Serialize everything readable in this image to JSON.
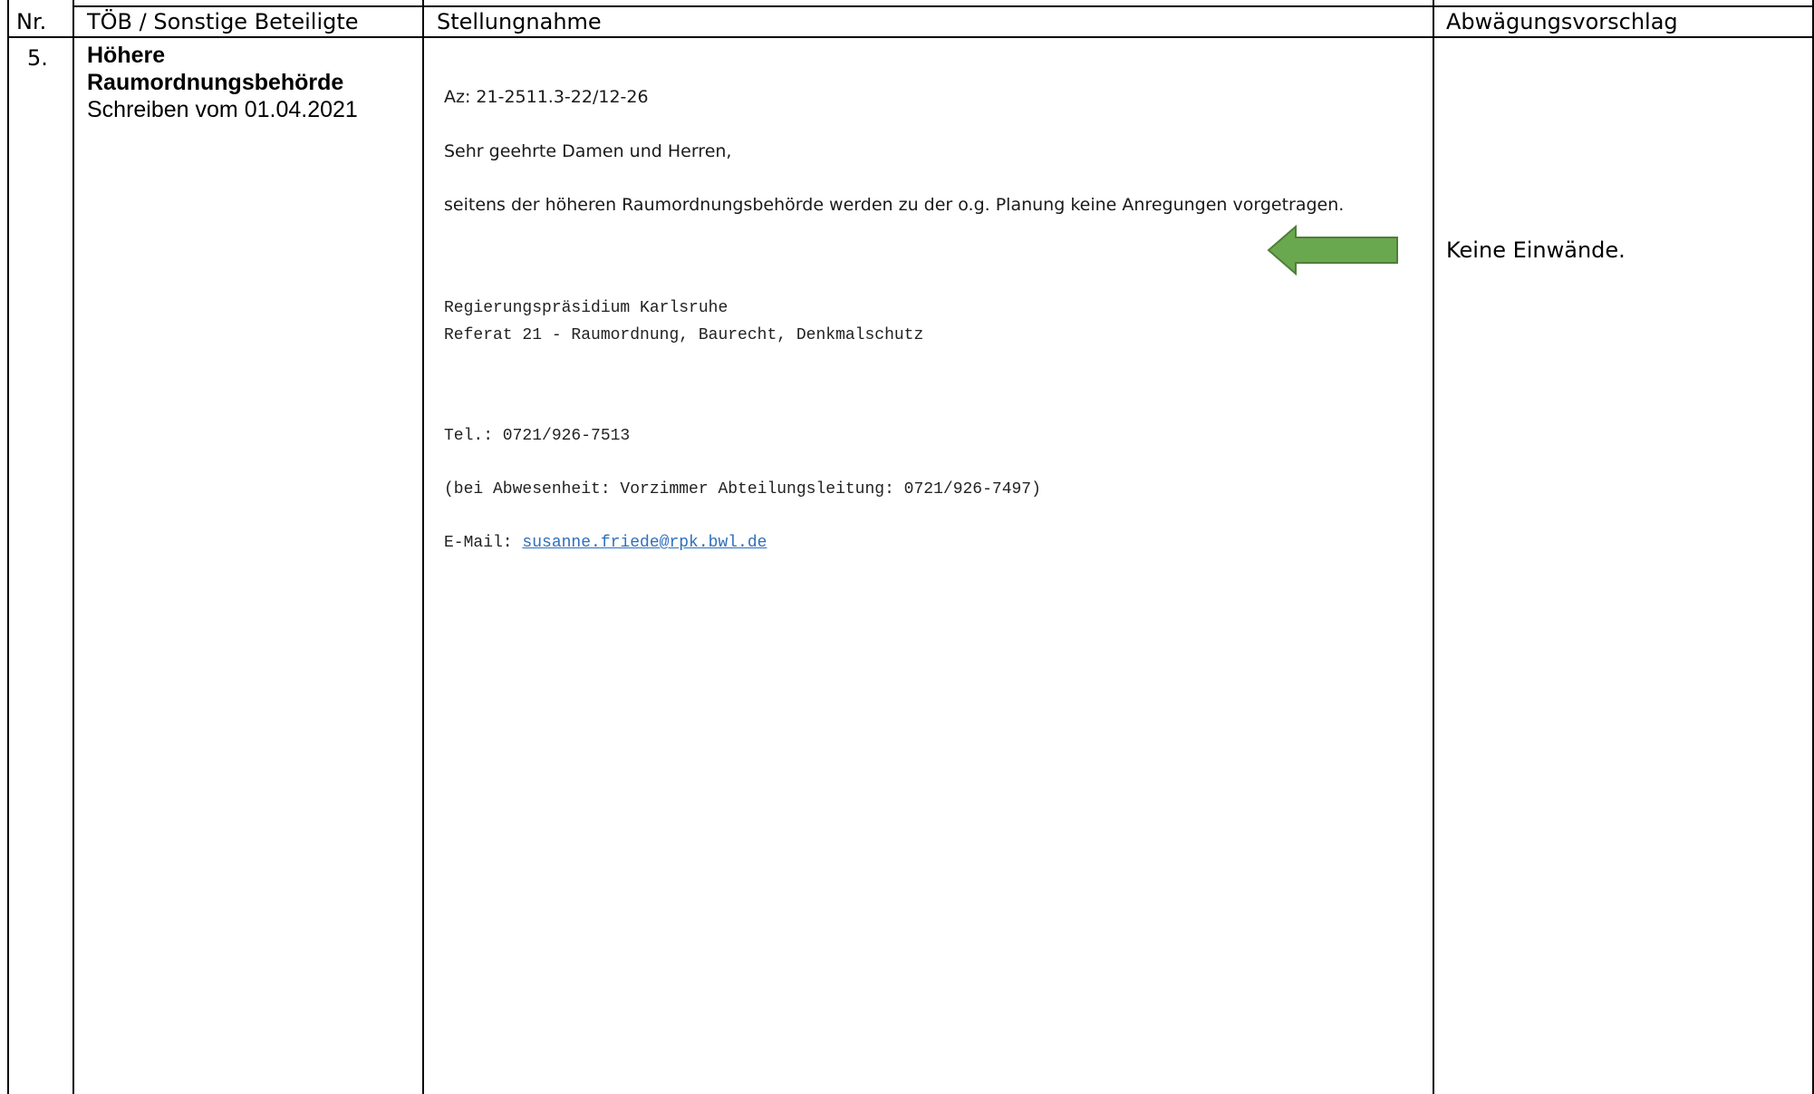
{
  "table": {
    "headers": {
      "nr": "Nr.",
      "toeb": "TÖB / Sonstige Beteiligte",
      "stellungnahme": "Stellungnahme",
      "abwaegung": "Abwägungsvorschlag"
    },
    "row": {
      "nr": "5.",
      "toeb_name": "Höhere Raumordnungsbehörde",
      "toeb_date": "Schreiben vom 01.04.2021",
      "letter": {
        "az": "Az: 21-2511.3-22/12-26",
        "salutation": "Sehr geehrte Damen und Herren,",
        "body": "seitens der höheren Raumordnungsbehörde werden zu der o.g. Planung keine Anregungen vorgetragen.",
        "org_line1": "Regierungspräsidium Karlsruhe",
        "org_line2": "Referat 21 - Raumordnung, Baurecht, Denkmalschutz",
        "tel": "Tel.: 0721/926-7513",
        "absence": "(bei Abwesenheit: Vorzimmer Abteilungsleitung: 0721/926-7497)",
        "email_label": "E-Mail: ",
        "email": "susanne.friede@rpk.bwl.de"
      },
      "abwaegung": "Keine Einwände."
    }
  },
  "colors": {
    "arrow_fill": "#6aa84f",
    "arrow_stroke": "#4e7f37",
    "link": "#2e6fbe"
  },
  "icons": {
    "arrow": "left-arrow-icon"
  }
}
